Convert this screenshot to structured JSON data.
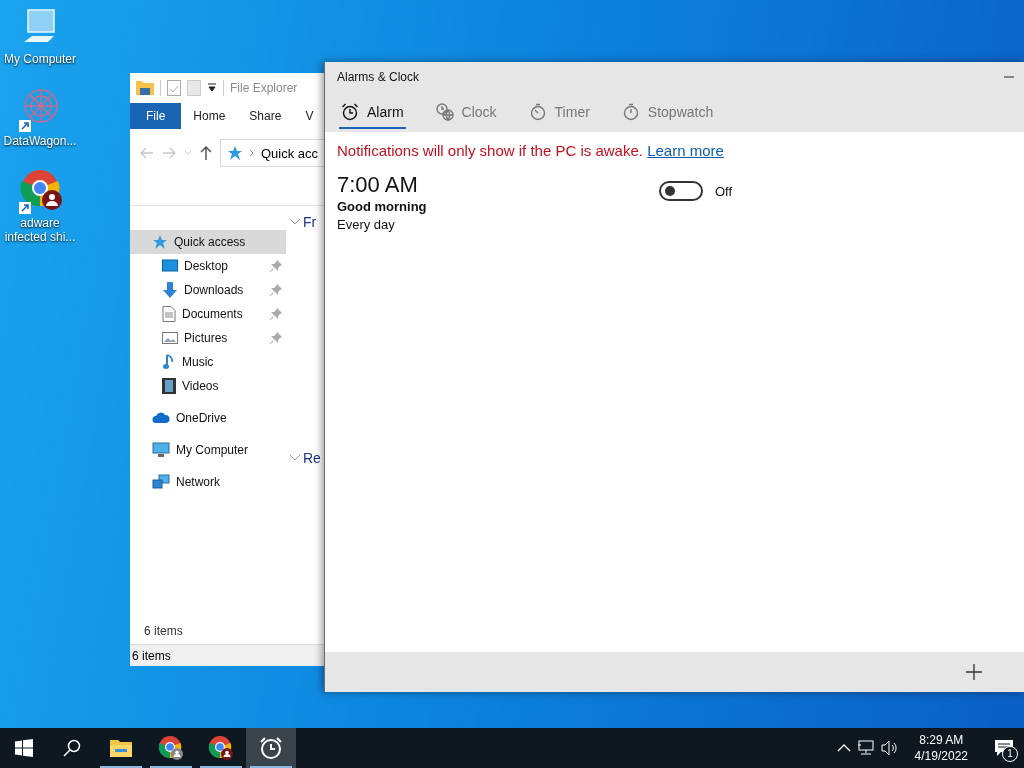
{
  "desktop_icons": [
    {
      "label": "My Computer",
      "kind": "computer"
    },
    {
      "label": "DataWagon...",
      "kind": "shortcut-app"
    },
    {
      "label": "adware infected shi...",
      "kind": "browser-shortcut"
    }
  ],
  "file_explorer": {
    "title": "File Explorer",
    "ribbon_tabs": [
      {
        "label": "File",
        "selected": true
      },
      {
        "label": "Home",
        "selected": false
      },
      {
        "label": "Share",
        "selected": false
      },
      {
        "label": "V",
        "selected": false
      }
    ],
    "address": "Quick acc",
    "nav_items": [
      {
        "label": "Quick access",
        "kind": "star",
        "selected": true,
        "children": [
          {
            "label": "Desktop",
            "kind": "desktop",
            "selected": false,
            "pinned": true
          },
          {
            "label": "Downloads",
            "kind": "download",
            "selected": false,
            "pinned": true
          },
          {
            "label": "Documents",
            "kind": "document",
            "selected": false,
            "pinned": true
          },
          {
            "label": "Pictures",
            "kind": "pictures",
            "selected": false,
            "pinned": true
          },
          {
            "label": "Music",
            "kind": "music",
            "selected": false,
            "pinned": false
          },
          {
            "label": "Videos",
            "kind": "video",
            "selected": false,
            "pinned": false
          }
        ]
      },
      {
        "label": "OneDrive",
        "kind": "cloud",
        "selected": false
      },
      {
        "label": "My Computer",
        "kind": "computer",
        "selected": false
      },
      {
        "label": "Network",
        "kind": "network",
        "selected": false
      }
    ],
    "sections": [
      "Fr",
      "Re"
    ],
    "item_count": "6 items",
    "status_bar": "6 items"
  },
  "alarms_window": {
    "title": "Alarms & Clock",
    "tabs": [
      {
        "label": "Alarm",
        "kind": "alarm",
        "selected": true
      },
      {
        "label": "Clock",
        "kind": "clock",
        "selected": false
      },
      {
        "label": "Timer",
        "kind": "timer",
        "selected": false
      },
      {
        "label": "Stopwatch",
        "kind": "stopwatch",
        "selected": false
      }
    ],
    "notice": "Notifications will only show if the PC is awake.",
    "notice_link": "Learn more",
    "alarms": [
      {
        "time": "7:00 AM",
        "name": "Good morning",
        "repeat": "Every day",
        "on": false,
        "state_label": "Off"
      }
    ]
  },
  "taskbar": {
    "apps": [
      {
        "kind": "explorer",
        "running": true,
        "active": false
      },
      {
        "kind": "browser-gray",
        "running": true,
        "active": false
      },
      {
        "kind": "browser-red",
        "running": true,
        "active": false
      },
      {
        "kind": "alarm",
        "running": true,
        "active": true
      }
    ],
    "time": "8:29 AM",
    "date": "4/19/2022",
    "notification_count": "1"
  }
}
